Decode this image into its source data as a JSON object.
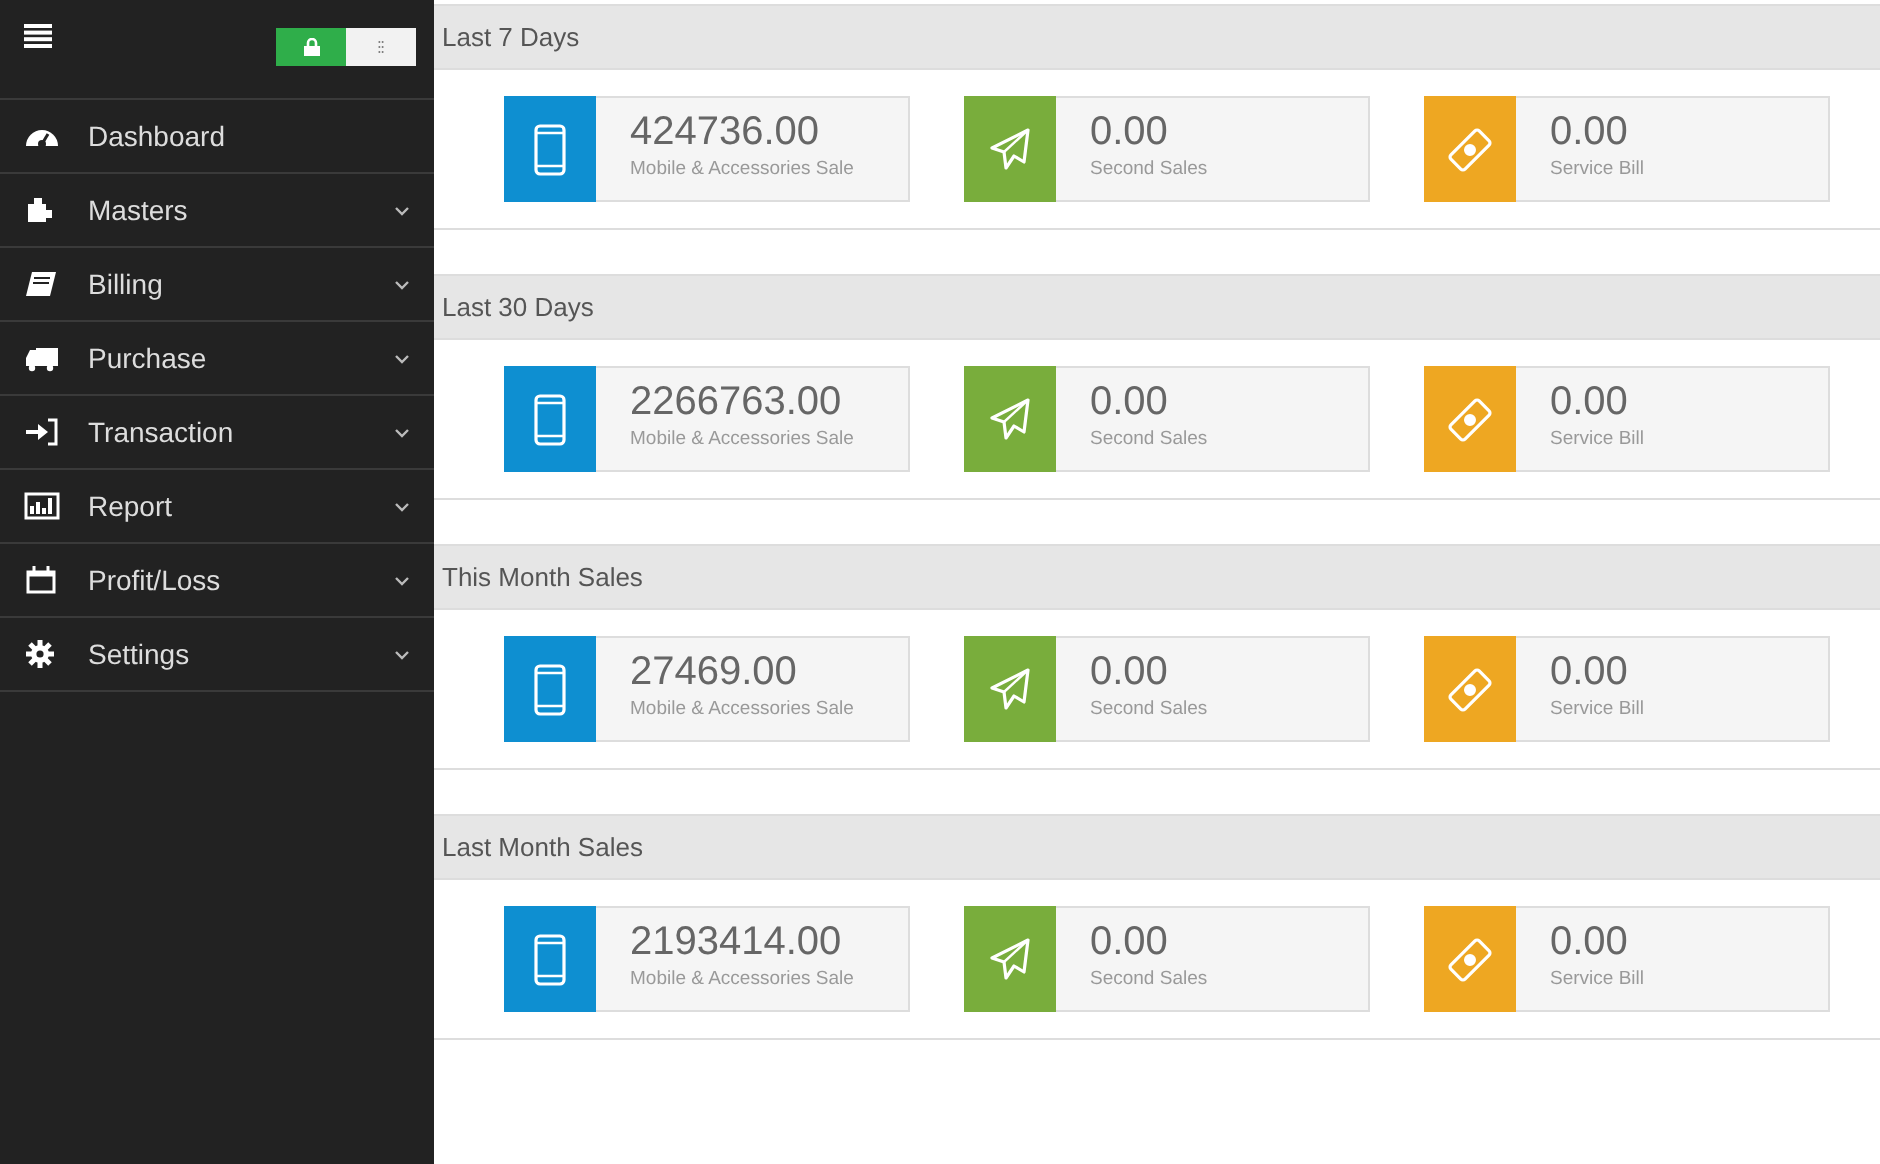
{
  "sidebar": {
    "lock_toggle": {
      "on": true
    },
    "items": [
      {
        "label": "Dashboard",
        "kind": "dashboard",
        "has_submenu": false
      },
      {
        "label": "Masters",
        "kind": "puzzle",
        "has_submenu": true
      },
      {
        "label": "Billing",
        "kind": "book",
        "has_submenu": true
      },
      {
        "label": "Purchase",
        "kind": "truck",
        "has_submenu": true
      },
      {
        "label": "Transaction",
        "kind": "signin",
        "has_submenu": true
      },
      {
        "label": "Report",
        "kind": "chart",
        "has_submenu": true
      },
      {
        "label": "Profit/Loss",
        "kind": "calendar",
        "has_submenu": true
      },
      {
        "label": "Settings",
        "kind": "gear",
        "has_submenu": true
      }
    ]
  },
  "sections": [
    {
      "title": "Last 7 Days",
      "cards": [
        {
          "kind": "mobile",
          "color": "#0e8fd1",
          "value": "424736.00",
          "label": "Mobile & Accessories Sale"
        },
        {
          "kind": "plane",
          "color": "#79ad3c",
          "value": "0.00",
          "label": "Second Sales"
        },
        {
          "kind": "money",
          "color": "#eea722",
          "value": "0.00",
          "label": "Service Bill"
        }
      ]
    },
    {
      "title": "Last 30 Days",
      "cards": [
        {
          "kind": "mobile",
          "color": "#0e8fd1",
          "value": "2266763.00",
          "label": "Mobile & Accessories Sale"
        },
        {
          "kind": "plane",
          "color": "#79ad3c",
          "value": "0.00",
          "label": "Second Sales"
        },
        {
          "kind": "money",
          "color": "#eea722",
          "value": "0.00",
          "label": "Service Bill"
        }
      ]
    },
    {
      "title": "This Month Sales",
      "cards": [
        {
          "kind": "mobile",
          "color": "#0e8fd1",
          "value": "27469.00",
          "label": "Mobile & Accessories Sale"
        },
        {
          "kind": "plane",
          "color": "#79ad3c",
          "value": "0.00",
          "label": "Second Sales"
        },
        {
          "kind": "money",
          "color": "#eea722",
          "value": "0.00",
          "label": "Service Bill"
        }
      ]
    },
    {
      "title": "Last Month Sales",
      "cards": [
        {
          "kind": "mobile",
          "color": "#0e8fd1",
          "value": "2193414.00",
          "label": "Mobile & Accessories Sale"
        },
        {
          "kind": "plane",
          "color": "#79ad3c",
          "value": "0.00",
          "label": "Second Sales"
        },
        {
          "kind": "money",
          "color": "#eea722",
          "value": "0.00",
          "label": "Service Bill"
        }
      ]
    }
  ]
}
